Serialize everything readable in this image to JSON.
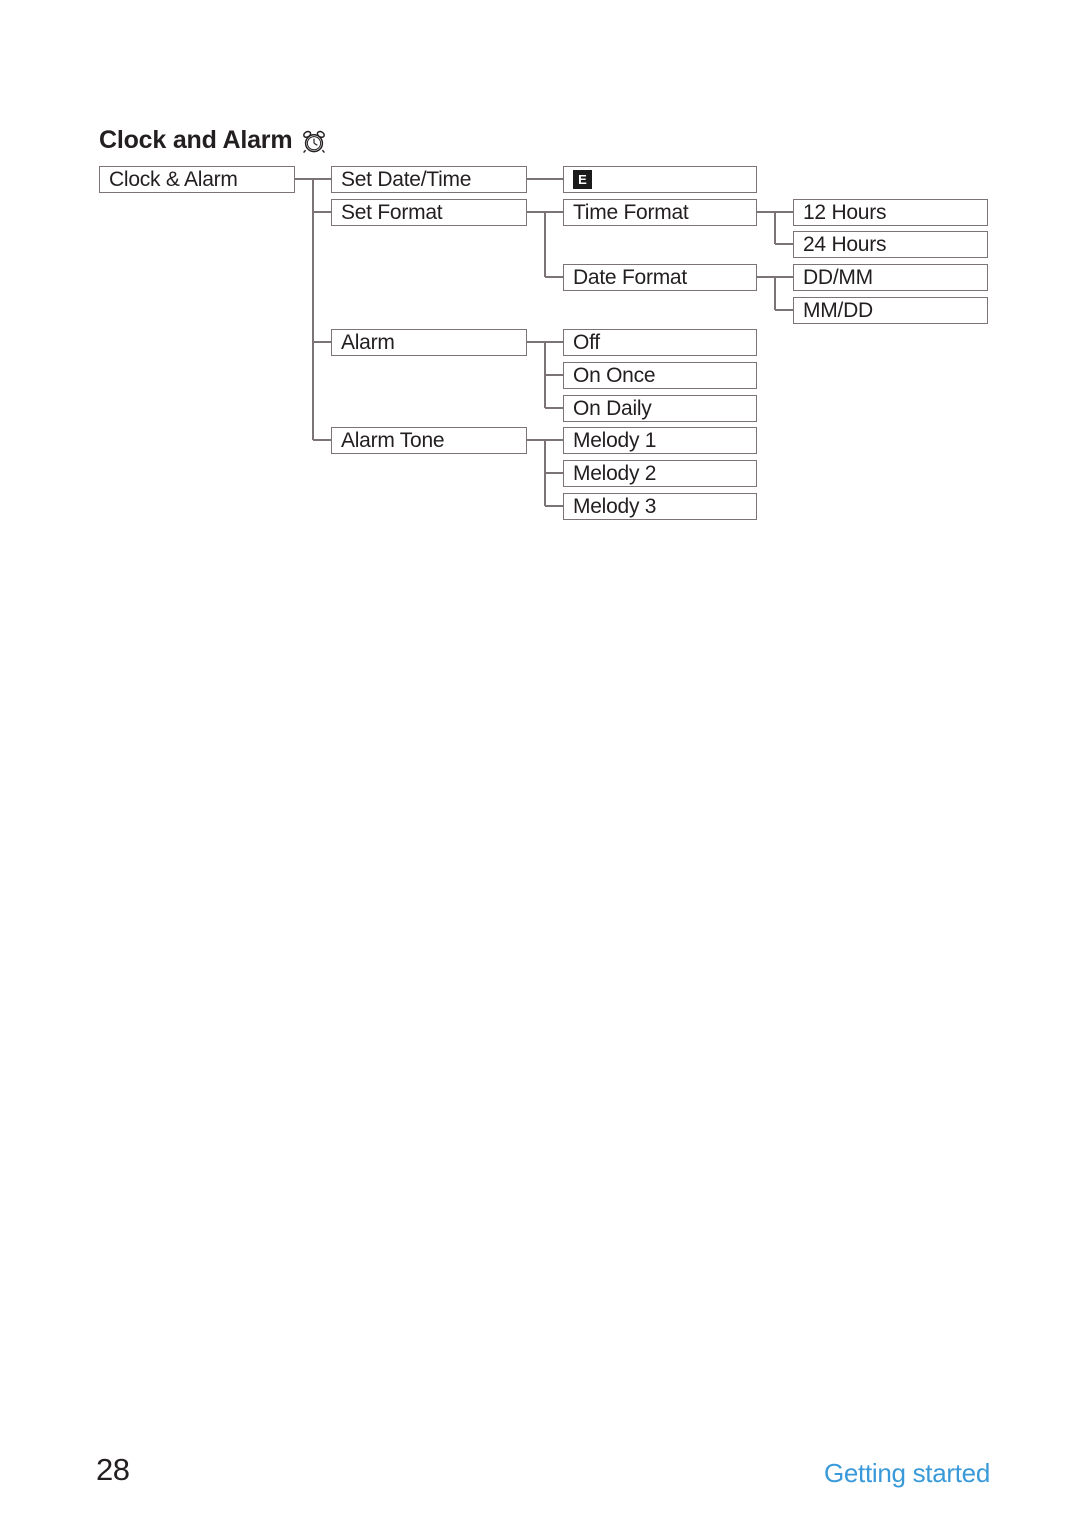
{
  "page": {
    "title": "Clock and Alarm",
    "title_icon": "alarm-clock-icon",
    "number": "28",
    "footer_section": "Getting started"
  },
  "colors": {
    "text": "#231f20",
    "box_border": "#7b7375",
    "connector": "#7b7375",
    "footer_accent": "#3a9ad9",
    "badge_background": "#1b1b1b",
    "badge_text": "#ffffff",
    "page_background": "#ffffff"
  },
  "diagram": {
    "type": "menu-tree",
    "root": {
      "label": "Clock & Alarm"
    },
    "level2": [
      {
        "id": "set-date-time",
        "label": "Set Date/Time"
      },
      {
        "id": "set-format",
        "label": "Set Format"
      },
      {
        "id": "alarm",
        "label": "Alarm"
      },
      {
        "id": "alarm-tone",
        "label": "Alarm Tone"
      }
    ],
    "level3": [
      {
        "id": "date-time-edit",
        "label": "",
        "badge": "E",
        "parent": "set-date-time"
      },
      {
        "id": "time-format",
        "label": "Time Format",
        "parent": "set-format"
      },
      {
        "id": "date-format",
        "label": "Date Format",
        "parent": "set-format"
      },
      {
        "id": "alarm-off",
        "label": "Off",
        "parent": "alarm"
      },
      {
        "id": "alarm-on-once",
        "label": "On Once",
        "parent": "alarm"
      },
      {
        "id": "alarm-on-daily",
        "label": "On Daily",
        "parent": "alarm"
      },
      {
        "id": "melody-1",
        "label": "Melody 1",
        "parent": "alarm-tone"
      },
      {
        "id": "melody-2",
        "label": "Melody 2",
        "parent": "alarm-tone"
      },
      {
        "id": "melody-3",
        "label": "Melody 3",
        "parent": "alarm-tone"
      }
    ],
    "level4": [
      {
        "id": "12-hours",
        "label": "12 Hours",
        "parent": "time-format"
      },
      {
        "id": "24-hours",
        "label": "24 Hours",
        "parent": "time-format"
      },
      {
        "id": "dd-mm",
        "label": "DD/MM",
        "parent": "date-format"
      },
      {
        "id": "mm-dd",
        "label": "MM/DD",
        "parent": "date-format"
      }
    ]
  }
}
